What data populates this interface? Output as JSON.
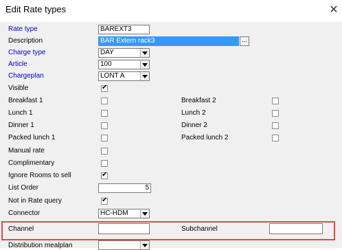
{
  "window": {
    "title": "Edit Rate types"
  },
  "fields": {
    "rate_type": {
      "label": "Rate type",
      "value": "BAREXT3"
    },
    "description": {
      "label": "Description",
      "value": "BAR Extern rack3",
      "ellipsis": "..."
    },
    "charge_type": {
      "label": "Charge type",
      "value": "DAY"
    },
    "article": {
      "label": "Article",
      "value": "100"
    },
    "chargeplan": {
      "label": "Chargeplan",
      "value": "LONT A"
    },
    "visible": {
      "label": "Visible",
      "checked": true
    },
    "breakfast1": {
      "label": "Breakfast 1",
      "checked": false
    },
    "breakfast2": {
      "label": "Breakfast 2",
      "checked": false
    },
    "lunch1": {
      "label": "Lunch 1",
      "checked": false
    },
    "lunch2": {
      "label": "Lunch 2",
      "checked": false
    },
    "dinner1": {
      "label": "Dinner 1",
      "checked": false
    },
    "dinner2": {
      "label": "Dinner 2",
      "checked": false
    },
    "packed_lunch1": {
      "label": "Packed lunch 1",
      "checked": false
    },
    "packed_lunch2": {
      "label": "Packed lunch 2",
      "checked": false
    },
    "manual_rate": {
      "label": "Manual rate",
      "checked": false
    },
    "complimentary": {
      "label": "Complimentary",
      "checked": false
    },
    "ignore_rooms": {
      "label": "Ignore Rooms to sell",
      "checked": true
    },
    "list_order": {
      "label": "List Order",
      "value": "5"
    },
    "not_in_rate_query": {
      "label": "Not in Rate query",
      "checked": true
    },
    "connector": {
      "label": "Connector",
      "value": "HC-HDM"
    },
    "channel": {
      "label": "Channel",
      "value": ""
    },
    "subchannel": {
      "label": "Subchannel",
      "value": ""
    },
    "distribution_mealplan": {
      "label": "Distribution mealplan",
      "value": ""
    }
  },
  "icons": {
    "close": "close-icon",
    "check": "check-icon",
    "dropdown": "chevron-down-icon"
  },
  "colors": {
    "link_label": "#0000cc",
    "highlight_border": "#e0484a",
    "selection": "#3399ff"
  }
}
